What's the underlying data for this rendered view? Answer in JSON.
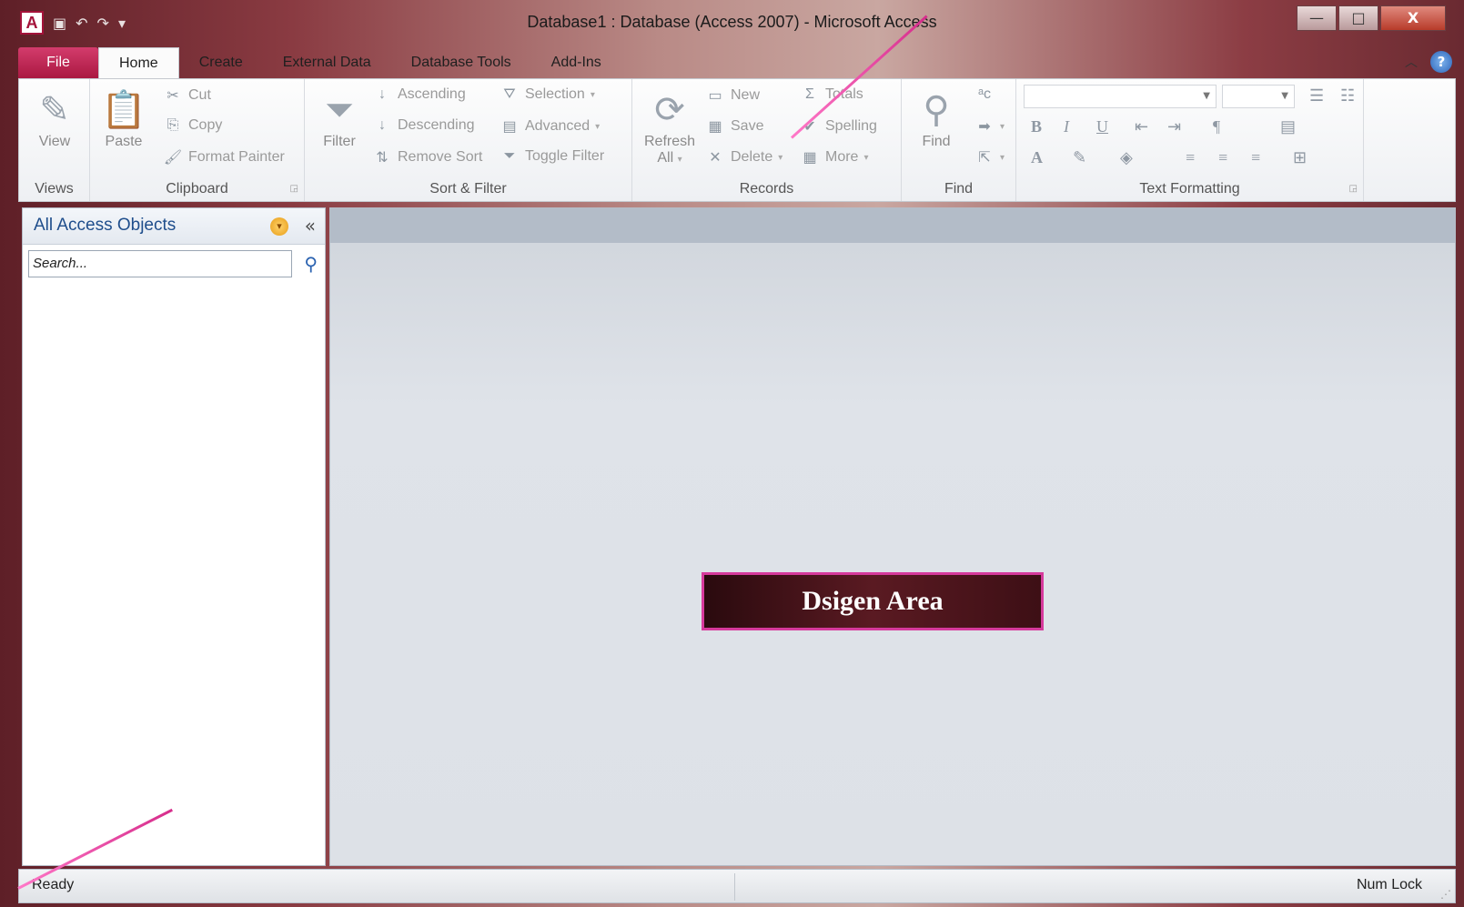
{
  "window": {
    "title": "Database1 : Database (Access 2007)  -  Microsoft Access",
    "app_icon": "A",
    "minimize": "—",
    "maximize": "□",
    "close": "X"
  },
  "tabs": [
    "File",
    "Home",
    "Create",
    "External Data",
    "Database Tools",
    "Add-Ins"
  ],
  "ribbon": {
    "views": {
      "label": "Views",
      "view": "View"
    },
    "clipboard": {
      "label": "Clipboard",
      "paste": "Paste",
      "cut": "Cut",
      "copy": "Copy",
      "format_painter": "Format Painter"
    },
    "sort_filter": {
      "label": "Sort & Filter",
      "filter": "Filter",
      "ascending": "Ascending",
      "descending": "Descending",
      "remove_sort": "Remove Sort",
      "selection": "Selection",
      "advanced": "Advanced",
      "toggle_filter": "Toggle Filter"
    },
    "records": {
      "label": "Records",
      "refresh": "Refresh",
      "refresh_all": "All",
      "new": "New",
      "save": "Save",
      "delete": "Delete",
      "totals": "Totals",
      "spelling": "Spelling",
      "more": "More"
    },
    "find": {
      "label": "Find",
      "find": "Find"
    },
    "text_formatting": {
      "label": "Text Formatting"
    }
  },
  "nav": {
    "title": "All Access Objects",
    "search_placeholder": "Search..."
  },
  "design": {
    "label": "Dsigen Area"
  },
  "status": {
    "left": "Ready",
    "right": "Num Lock"
  }
}
